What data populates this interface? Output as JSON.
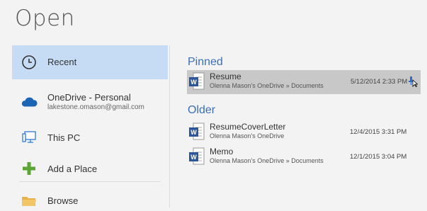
{
  "page": {
    "title": "Open"
  },
  "places": [
    {
      "label": "Recent",
      "sub": "",
      "icon": "clock-icon",
      "active": true
    },
    {
      "label": "OneDrive - Personal",
      "sub": "lakestone.omason@gmail.com",
      "icon": "cloud-icon"
    },
    {
      "label": "This PC",
      "sub": "",
      "icon": "computer-icon"
    },
    {
      "label": "Add a Place",
      "sub": "",
      "icon": "plus-icon"
    },
    {
      "label": "Browse",
      "sub": "",
      "icon": "folder-icon"
    }
  ],
  "sections": {
    "pinned": "Pinned",
    "older": "Older"
  },
  "pinned": [
    {
      "name": "Resume",
      "path": "Olenna Mason's OneDrive » Documents",
      "date": "5/12/2014 2:33 PM"
    }
  ],
  "older": [
    {
      "name": "ResumeCoverLetter",
      "path": "Olenna Mason's OneDrive",
      "date": "12/4/2015 3:31 PM"
    },
    {
      "name": "Memo",
      "path": "Olenna Mason's OneDrive » Documents",
      "date": "12/1/2015 3:04 PM"
    }
  ],
  "colors": {
    "accent": "#3a6fb8",
    "word": "#2b579a",
    "selected": "#c6dbf4",
    "hover": "#c8c8c8"
  }
}
